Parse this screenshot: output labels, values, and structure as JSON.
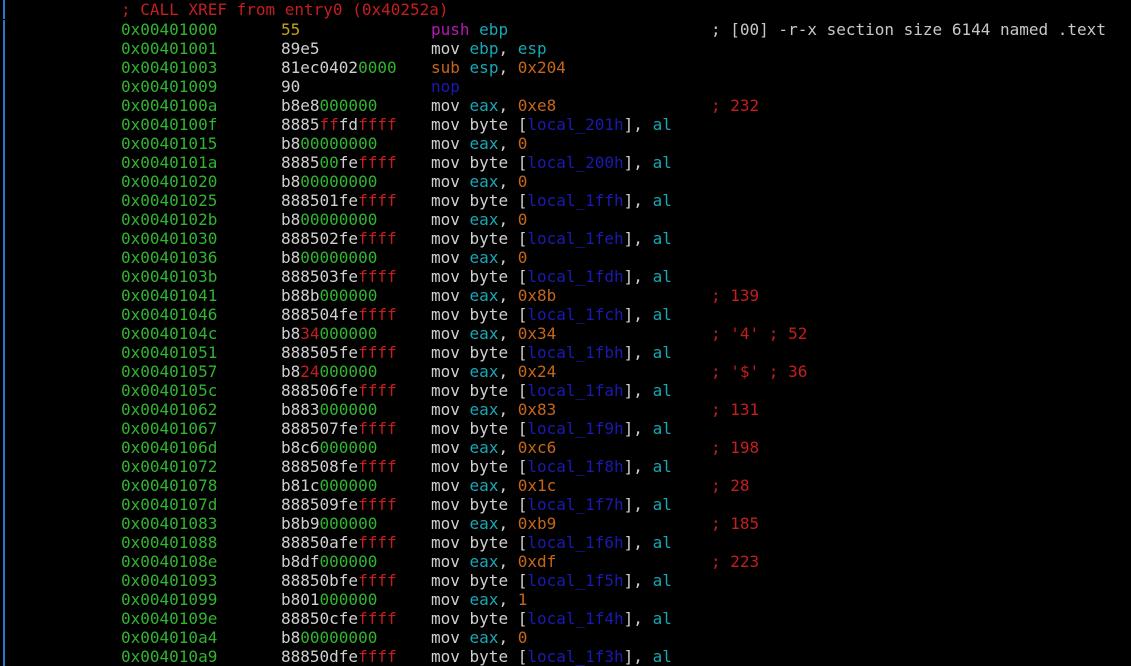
{
  "xref_comment": "; CALL XREF from entry0 (0x40252a)",
  "rows": [
    {
      "addr": "0x00401000",
      "bytes": [
        [
          "55",
          "yel"
        ]
      ],
      "instr": [
        [
          "push",
          "mag"
        ],
        [
          " ",
          "txt"
        ],
        [
          "ebp",
          "cyan"
        ]
      ],
      "comment": "; [00] -r-x section size 6144 named .text",
      "comment_color": "gray"
    },
    {
      "addr": "0x00401001",
      "bytes": [
        [
          "89e5",
          "txt"
        ]
      ],
      "instr": [
        [
          "mov",
          "txt"
        ],
        [
          " ",
          "txt"
        ],
        [
          "ebp",
          "cyan"
        ],
        [
          ", ",
          "txt"
        ],
        [
          "esp",
          "cyan"
        ]
      ],
      "comment": ""
    },
    {
      "addr": "0x00401003",
      "bytes": [
        [
          "81ec0402",
          "txt"
        ],
        [
          "0000",
          "grn"
        ]
      ],
      "instr": [
        [
          "sub",
          "orange"
        ],
        [
          " ",
          "txt"
        ],
        [
          "esp",
          "cyan"
        ],
        [
          ", ",
          "txt"
        ],
        [
          "0x204",
          "num"
        ]
      ],
      "comment": ""
    },
    {
      "addr": "0x00401009",
      "bytes": [
        [
          "90",
          "txt"
        ]
      ],
      "instr": [
        [
          "nop",
          "blue"
        ]
      ],
      "comment": ""
    },
    {
      "addr": "0x0040100a",
      "bytes": [
        [
          "b8e8",
          "txt"
        ],
        [
          "000000",
          "grn"
        ]
      ],
      "instr": [
        [
          "mov",
          "txt"
        ],
        [
          " ",
          "txt"
        ],
        [
          "eax",
          "cyan"
        ],
        [
          ", ",
          "txt"
        ],
        [
          "0xe8",
          "num"
        ]
      ],
      "comment": "; 232"
    },
    {
      "addr": "0x0040100f",
      "bytes": [
        [
          "8885",
          "txt"
        ],
        [
          "ff",
          "red"
        ],
        [
          "fd",
          "txt"
        ],
        [
          "ffff",
          "red"
        ]
      ],
      "instr": [
        [
          "mov",
          "txt"
        ],
        [
          " byte [",
          "txt"
        ],
        [
          "local_201h",
          "blue"
        ],
        [
          "], ",
          "txt"
        ],
        [
          "al",
          "cyan"
        ]
      ],
      "comment": ""
    },
    {
      "addr": "0x00401015",
      "bytes": [
        [
          "b8",
          "txt"
        ],
        [
          "00000000",
          "grn"
        ]
      ],
      "instr": [
        [
          "mov",
          "txt"
        ],
        [
          " ",
          "txt"
        ],
        [
          "eax",
          "cyan"
        ],
        [
          ", ",
          "txt"
        ],
        [
          "0",
          "num"
        ]
      ],
      "comment": ""
    },
    {
      "addr": "0x0040101a",
      "bytes": [
        [
          "8885",
          "txt"
        ],
        [
          "00",
          "grn"
        ],
        [
          "fe",
          "txt"
        ],
        [
          "ffff",
          "red"
        ]
      ],
      "instr": [
        [
          "mov",
          "txt"
        ],
        [
          " byte [",
          "txt"
        ],
        [
          "local_200h",
          "blue"
        ],
        [
          "], ",
          "txt"
        ],
        [
          "al",
          "cyan"
        ]
      ],
      "comment": ""
    },
    {
      "addr": "0x00401020",
      "bytes": [
        [
          "b8",
          "txt"
        ],
        [
          "00000000",
          "grn"
        ]
      ],
      "instr": [
        [
          "mov",
          "txt"
        ],
        [
          " ",
          "txt"
        ],
        [
          "eax",
          "cyan"
        ],
        [
          ", ",
          "txt"
        ],
        [
          "0",
          "num"
        ]
      ],
      "comment": ""
    },
    {
      "addr": "0x00401025",
      "bytes": [
        [
          "888501fe",
          "txt"
        ],
        [
          "ffff",
          "red"
        ]
      ],
      "instr": [
        [
          "mov",
          "txt"
        ],
        [
          " byte [",
          "txt"
        ],
        [
          "local_1ffh",
          "blue"
        ],
        [
          "], ",
          "txt"
        ],
        [
          "al",
          "cyan"
        ]
      ],
      "comment": ""
    },
    {
      "addr": "0x0040102b",
      "bytes": [
        [
          "b8",
          "txt"
        ],
        [
          "00000000",
          "grn"
        ]
      ],
      "instr": [
        [
          "mov",
          "txt"
        ],
        [
          " ",
          "txt"
        ],
        [
          "eax",
          "cyan"
        ],
        [
          ", ",
          "txt"
        ],
        [
          "0",
          "num"
        ]
      ],
      "comment": ""
    },
    {
      "addr": "0x00401030",
      "bytes": [
        [
          "888502fe",
          "txt"
        ],
        [
          "ffff",
          "red"
        ]
      ],
      "instr": [
        [
          "mov",
          "txt"
        ],
        [
          " byte [",
          "txt"
        ],
        [
          "local_1feh",
          "blue"
        ],
        [
          "], ",
          "txt"
        ],
        [
          "al",
          "cyan"
        ]
      ],
      "comment": ""
    },
    {
      "addr": "0x00401036",
      "bytes": [
        [
          "b8",
          "txt"
        ],
        [
          "00000000",
          "grn"
        ]
      ],
      "instr": [
        [
          "mov",
          "txt"
        ],
        [
          " ",
          "txt"
        ],
        [
          "eax",
          "cyan"
        ],
        [
          ", ",
          "txt"
        ],
        [
          "0",
          "num"
        ]
      ],
      "comment": ""
    },
    {
      "addr": "0x0040103b",
      "bytes": [
        [
          "888503fe",
          "txt"
        ],
        [
          "ffff",
          "red"
        ]
      ],
      "instr": [
        [
          "mov",
          "txt"
        ],
        [
          " byte [",
          "txt"
        ],
        [
          "local_1fdh",
          "blue"
        ],
        [
          "], ",
          "txt"
        ],
        [
          "al",
          "cyan"
        ]
      ],
      "comment": ""
    },
    {
      "addr": "0x00401041",
      "bytes": [
        [
          "b88b",
          "txt"
        ],
        [
          "000000",
          "grn"
        ]
      ],
      "instr": [
        [
          "mov",
          "txt"
        ],
        [
          " ",
          "txt"
        ],
        [
          "eax",
          "cyan"
        ],
        [
          ", ",
          "txt"
        ],
        [
          "0x8b",
          "num"
        ]
      ],
      "comment": "; 139"
    },
    {
      "addr": "0x00401046",
      "bytes": [
        [
          "888504fe",
          "txt"
        ],
        [
          "ffff",
          "red"
        ]
      ],
      "instr": [
        [
          "mov",
          "txt"
        ],
        [
          " byte [",
          "txt"
        ],
        [
          "local_1fch",
          "blue"
        ],
        [
          "], ",
          "txt"
        ],
        [
          "al",
          "cyan"
        ]
      ],
      "comment": ""
    },
    {
      "addr": "0x0040104c",
      "bytes": [
        [
          "b8",
          "txt"
        ],
        [
          "34",
          "red"
        ],
        [
          "000000",
          "grn"
        ]
      ],
      "instr": [
        [
          "mov",
          "txt"
        ],
        [
          " ",
          "txt"
        ],
        [
          "eax",
          "cyan"
        ],
        [
          ", ",
          "txt"
        ],
        [
          "0x34",
          "num"
        ]
      ],
      "comment": "; '4' ; 52"
    },
    {
      "addr": "0x00401051",
      "bytes": [
        [
          "888505fe",
          "txt"
        ],
        [
          "ffff",
          "red"
        ]
      ],
      "instr": [
        [
          "mov",
          "txt"
        ],
        [
          " byte [",
          "txt"
        ],
        [
          "local_1fbh",
          "blue"
        ],
        [
          "], ",
          "txt"
        ],
        [
          "al",
          "cyan"
        ]
      ],
      "comment": ""
    },
    {
      "addr": "0x00401057",
      "bytes": [
        [
          "b8",
          "txt"
        ],
        [
          "24",
          "red"
        ],
        [
          "000000",
          "grn"
        ]
      ],
      "instr": [
        [
          "mov",
          "txt"
        ],
        [
          " ",
          "txt"
        ],
        [
          "eax",
          "cyan"
        ],
        [
          ", ",
          "txt"
        ],
        [
          "0x24",
          "num"
        ]
      ],
      "comment": "; '$' ; 36"
    },
    {
      "addr": "0x0040105c",
      "bytes": [
        [
          "888506fe",
          "txt"
        ],
        [
          "ffff",
          "red"
        ]
      ],
      "instr": [
        [
          "mov",
          "txt"
        ],
        [
          " byte [",
          "txt"
        ],
        [
          "local_1fah",
          "blue"
        ],
        [
          "], ",
          "txt"
        ],
        [
          "al",
          "cyan"
        ]
      ],
      "comment": ""
    },
    {
      "addr": "0x00401062",
      "bytes": [
        [
          "b883",
          "txt"
        ],
        [
          "000000",
          "grn"
        ]
      ],
      "instr": [
        [
          "mov",
          "txt"
        ],
        [
          " ",
          "txt"
        ],
        [
          "eax",
          "cyan"
        ],
        [
          ", ",
          "txt"
        ],
        [
          "0x83",
          "num"
        ]
      ],
      "comment": "; 131"
    },
    {
      "addr": "0x00401067",
      "bytes": [
        [
          "888507fe",
          "txt"
        ],
        [
          "ffff",
          "red"
        ]
      ],
      "instr": [
        [
          "mov",
          "txt"
        ],
        [
          " byte [",
          "txt"
        ],
        [
          "local_1f9h",
          "blue"
        ],
        [
          "], ",
          "txt"
        ],
        [
          "al",
          "cyan"
        ]
      ],
      "comment": ""
    },
    {
      "addr": "0x0040106d",
      "bytes": [
        [
          "b8c6",
          "txt"
        ],
        [
          "000000",
          "grn"
        ]
      ],
      "instr": [
        [
          "mov",
          "txt"
        ],
        [
          " ",
          "txt"
        ],
        [
          "eax",
          "cyan"
        ],
        [
          ", ",
          "txt"
        ],
        [
          "0xc6",
          "num"
        ]
      ],
      "comment": "; 198"
    },
    {
      "addr": "0x00401072",
      "bytes": [
        [
          "888508fe",
          "txt"
        ],
        [
          "ffff",
          "red"
        ]
      ],
      "instr": [
        [
          "mov",
          "txt"
        ],
        [
          " byte [",
          "txt"
        ],
        [
          "local_1f8h",
          "blue"
        ],
        [
          "], ",
          "txt"
        ],
        [
          "al",
          "cyan"
        ]
      ],
      "comment": ""
    },
    {
      "addr": "0x00401078",
      "bytes": [
        [
          "b81c",
          "txt"
        ],
        [
          "000000",
          "grn"
        ]
      ],
      "instr": [
        [
          "mov",
          "txt"
        ],
        [
          " ",
          "txt"
        ],
        [
          "eax",
          "cyan"
        ],
        [
          ", ",
          "txt"
        ],
        [
          "0x1c",
          "num"
        ]
      ],
      "comment": "; 28"
    },
    {
      "addr": "0x0040107d",
      "bytes": [
        [
          "888509fe",
          "txt"
        ],
        [
          "ffff",
          "red"
        ]
      ],
      "instr": [
        [
          "mov",
          "txt"
        ],
        [
          " byte [",
          "txt"
        ],
        [
          "local_1f7h",
          "blue"
        ],
        [
          "], ",
          "txt"
        ],
        [
          "al",
          "cyan"
        ]
      ],
      "comment": ""
    },
    {
      "addr": "0x00401083",
      "bytes": [
        [
          "b8b9",
          "txt"
        ],
        [
          "000000",
          "grn"
        ]
      ],
      "instr": [
        [
          "mov",
          "txt"
        ],
        [
          " ",
          "txt"
        ],
        [
          "eax",
          "cyan"
        ],
        [
          ", ",
          "txt"
        ],
        [
          "0xb9",
          "num"
        ]
      ],
      "comment": "; 185"
    },
    {
      "addr": "0x00401088",
      "bytes": [
        [
          "88850afe",
          "txt"
        ],
        [
          "ffff",
          "red"
        ]
      ],
      "instr": [
        [
          "mov",
          "txt"
        ],
        [
          " byte [",
          "txt"
        ],
        [
          "local_1f6h",
          "blue"
        ],
        [
          "], ",
          "txt"
        ],
        [
          "al",
          "cyan"
        ]
      ],
      "comment": ""
    },
    {
      "addr": "0x0040108e",
      "bytes": [
        [
          "b8df",
          "txt"
        ],
        [
          "000000",
          "grn"
        ]
      ],
      "instr": [
        [
          "mov",
          "txt"
        ],
        [
          " ",
          "txt"
        ],
        [
          "eax",
          "cyan"
        ],
        [
          ", ",
          "txt"
        ],
        [
          "0xdf",
          "num"
        ]
      ],
      "comment": "; 223"
    },
    {
      "addr": "0x00401093",
      "bytes": [
        [
          "88850bfe",
          "txt"
        ],
        [
          "ffff",
          "red"
        ]
      ],
      "instr": [
        [
          "mov",
          "txt"
        ],
        [
          " byte [",
          "txt"
        ],
        [
          "local_1f5h",
          "blue"
        ],
        [
          "], ",
          "txt"
        ],
        [
          "al",
          "cyan"
        ]
      ],
      "comment": ""
    },
    {
      "addr": "0x00401099",
      "bytes": [
        [
          "b801",
          "txt"
        ],
        [
          "000000",
          "grn"
        ]
      ],
      "instr": [
        [
          "mov",
          "txt"
        ],
        [
          " ",
          "txt"
        ],
        [
          "eax",
          "cyan"
        ],
        [
          ", ",
          "txt"
        ],
        [
          "1",
          "num"
        ]
      ],
      "comment": ""
    },
    {
      "addr": "0x0040109e",
      "bytes": [
        [
          "88850cfe",
          "txt"
        ],
        [
          "ffff",
          "red"
        ]
      ],
      "instr": [
        [
          "mov",
          "txt"
        ],
        [
          " byte [",
          "txt"
        ],
        [
          "local_1f4h",
          "blue"
        ],
        [
          "], ",
          "txt"
        ],
        [
          "al",
          "cyan"
        ]
      ],
      "comment": ""
    },
    {
      "addr": "0x004010a4",
      "bytes": [
        [
          "b8",
          "txt"
        ],
        [
          "00000000",
          "grn"
        ]
      ],
      "instr": [
        [
          "mov",
          "txt"
        ],
        [
          " ",
          "txt"
        ],
        [
          "eax",
          "cyan"
        ],
        [
          ", ",
          "txt"
        ],
        [
          "0",
          "num"
        ]
      ],
      "comment": ""
    },
    {
      "addr": "0x004010a9",
      "bytes": [
        [
          "88850dfe",
          "txt"
        ],
        [
          "ffff",
          "red"
        ]
      ],
      "instr": [
        [
          "mov",
          "txt"
        ],
        [
          " byte [",
          "txt"
        ],
        [
          "local_1f3h",
          "blue"
        ],
        [
          "], ",
          "txt"
        ],
        [
          "al",
          "cyan"
        ]
      ],
      "comment": ""
    }
  ]
}
